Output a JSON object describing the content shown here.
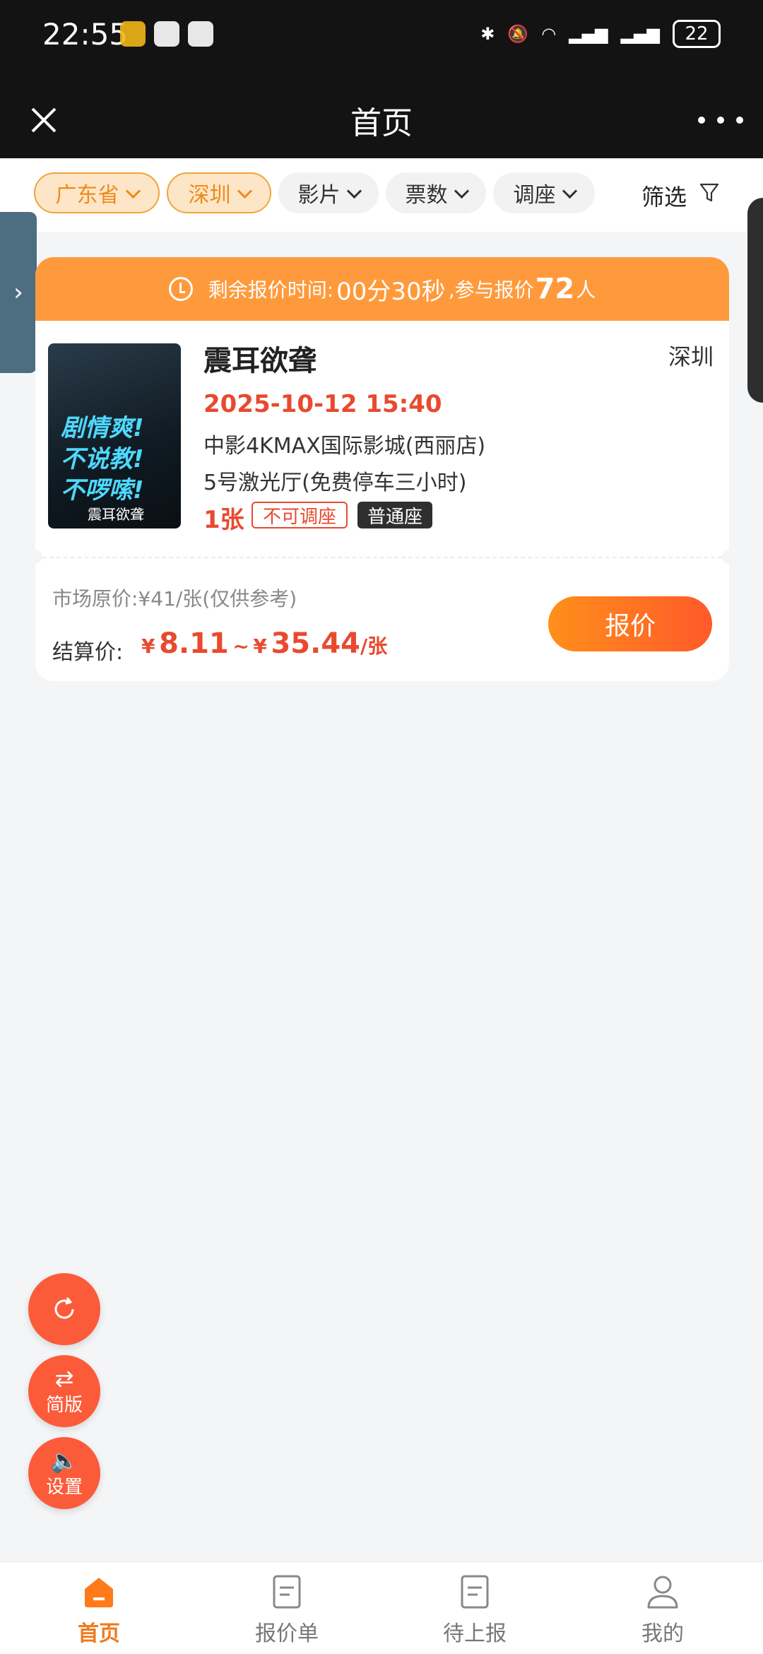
{
  "status_bar": {
    "time": "22:55",
    "battery": "22"
  },
  "title_bar": {
    "title": "首页"
  },
  "filters": [
    {
      "label": "广东省"
    },
    {
      "label": "深圳"
    },
    {
      "label": "影片"
    },
    {
      "label": "票数"
    },
    {
      "label": "调座"
    }
  ],
  "filter_button": {
    "label": "筛选"
  },
  "card": {
    "timer": {
      "prefix": "剩余报价时间:",
      "time": "00分30秒",
      "middle": ",参与报价",
      "count": "72",
      "suffix": "人"
    },
    "poster": {
      "line1": "剧情爽!",
      "line2": "不说教!",
      "line3": "不啰嗦!",
      "sub": "震耳欲聋"
    },
    "movie_title": "震耳欲聋",
    "city": "深圳",
    "datetime": "2025-10-12 15:40",
    "cinema": "中影4KMAX国际影城(西丽店)",
    "hall": "5号激光厅(免费停车三小时)",
    "tickets": "1张",
    "tag_no_adjust": "不可调座",
    "tag_seat_type": "普通座",
    "market_price": "市场原价:¥41/张(仅供参考)",
    "settle_label": "结算价:",
    "settle_currency": "¥",
    "settle_min": "8.11",
    "settle_tilde": "~",
    "settle_max": "35.44",
    "settle_unit": "/张",
    "quote_button": "报价"
  },
  "fabs": {
    "simple": "简版",
    "settings": "设置"
  },
  "nav": [
    {
      "label": "首页"
    },
    {
      "label": "报价单"
    },
    {
      "label": "待上报"
    },
    {
      "label": "我的"
    }
  ],
  "colors": {
    "accent": "#ff9a3c",
    "price_red": "#e84a2f",
    "fab": "#fc5b3a"
  }
}
